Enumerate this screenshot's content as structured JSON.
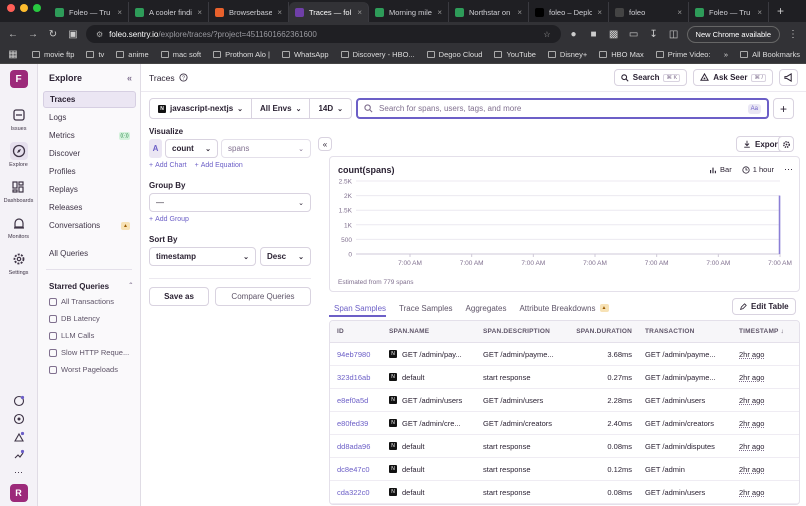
{
  "browser": {
    "tabs": [
      {
        "label": "Foleo — Tru",
        "color": "#2e9c59",
        "active": false
      },
      {
        "label": "A cooler findi",
        "color": "#2e9c59",
        "active": false
      },
      {
        "label": "Browserbase",
        "color": "#e8612c",
        "active": false
      },
      {
        "label": "Traces — fol",
        "color": "#6f3fa8",
        "active": true
      },
      {
        "label": "Morning mile",
        "color": "#2e9c59",
        "active": false
      },
      {
        "label": "Northstar on",
        "color": "#2e9c59",
        "active": false
      },
      {
        "label": "foleo – Deplo",
        "color": "#000000",
        "active": false
      },
      {
        "label": "foleo",
        "color": "#444444",
        "active": false
      },
      {
        "label": "Foleo — Tru",
        "color": "#2e9c59",
        "active": false
      }
    ],
    "url_host": "foleo.sentry.io",
    "url_path": "/explore/traces/?project=4511601662361600",
    "new_chrome": "New Chrome available",
    "bookmarks": [
      "movie ftp",
      "tv",
      "anime",
      "mac soft",
      "Prothom Alo |",
      "WhatsApp",
      "Discovery - HBO...",
      "Degoo Cloud",
      "YouTube",
      "Disney+",
      "HBO Max",
      "Prime Video:"
    ],
    "all_bookmarks": "All Bookmarks"
  },
  "rail": {
    "org_initial": "F",
    "items": [
      {
        "label": "Issues",
        "icon": "issues-icon",
        "active": false
      },
      {
        "label": "Explore",
        "icon": "compass-icon",
        "active": true
      },
      {
        "label": "Dashboards",
        "icon": "dashboard-icon",
        "active": false
      },
      {
        "label": "Monitors",
        "icon": "siren-icon",
        "active": false
      },
      {
        "label": "Settings",
        "icon": "gear-icon",
        "active": false
      }
    ],
    "user_initial": "R"
  },
  "subnav": {
    "title": "Explore",
    "items": [
      "Traces",
      "Logs",
      "Metrics",
      "Discover",
      "Profiles",
      "Replays",
      "Releases",
      "Conversations"
    ],
    "all_queries": "All Queries",
    "starred_title": "Starred Queries",
    "starred": [
      "All Transactions",
      "DB Latency",
      "LLM Calls",
      "Slow HTTP Reque...",
      "Worst Pageloads"
    ]
  },
  "header": {
    "title": "Traces",
    "search_label": "Search",
    "search_kbd": "⌘ K",
    "ask_label": "Ask Seer",
    "ask_kbd": "⌘ /"
  },
  "filters": {
    "project": "javascript-nextjs",
    "env": "All Envs",
    "period": "14D",
    "search_placeholder": "Search for spans, users, tags, and more",
    "aa": "Aa"
  },
  "query": {
    "visualize_label": "Visualize",
    "agg_letter": "A",
    "agg_func": "count",
    "agg_field": "spans",
    "add_chart": "Add Chart",
    "add_equation": "Add Equation",
    "group_by_label": "Group By",
    "group_by_value": "—",
    "add_group": "Add Group",
    "sort_by_label": "Sort By",
    "sort_field": "timestamp",
    "sort_dir": "Desc",
    "save_as": "Save as",
    "compare": "Compare Queries"
  },
  "chart_toolbar": {
    "export": "Export",
    "type_label": "Bar",
    "interval_label": "1 hour"
  },
  "chart_data": {
    "type": "bar",
    "title": "count(spans)",
    "y_ticks": [
      "2.5K",
      "2K",
      "1.5K",
      "1K",
      "500",
      "0"
    ],
    "ylim": [
      0,
      2500
    ],
    "x_tick_labels": [
      "7:00 AM",
      "7:00 AM",
      "7:00 AM",
      "7:00 AM",
      "7:00 AM",
      "7:00 AM",
      "7:00 AM"
    ],
    "num_buckets": 336,
    "series": [
      {
        "values_nonzero": [
          {
            "bucket": 335,
            "value": 2000
          }
        ]
      }
    ],
    "grid": true,
    "color": "#8b7fd6",
    "footer": "Estimated from 779 spans"
  },
  "table_tabs": [
    "Span Samples",
    "Trace Samples",
    "Aggregates",
    "Attribute Breakdowns"
  ],
  "edit_table": "Edit Table",
  "table": {
    "columns": [
      "ID",
      "SPAN.NAME",
      "SPAN.DESCRIPTION",
      "SPAN.DURATION",
      "TRANSACTION",
      "TIMESTAMP"
    ],
    "rows": [
      {
        "id": "94eb7980",
        "name": "GET /admin/pay...",
        "desc": "GET /admin/payme...",
        "dur": "3.68ms",
        "txn": "GET /admin/payme...",
        "ts": "2hr ago"
      },
      {
        "id": "323d16ab",
        "name": "default",
        "desc": "start response",
        "dur": "0.27ms",
        "txn": "GET /admin/payme...",
        "ts": "2hr ago"
      },
      {
        "id": "e8ef0a5d",
        "name": "GET /admin/users",
        "desc": "GET /admin/users",
        "dur": "2.28ms",
        "txn": "GET /admin/users",
        "ts": "2hr ago"
      },
      {
        "id": "e80fed39",
        "name": "GET /admin/cre...",
        "desc": "GET /admin/creators",
        "dur": "2.40ms",
        "txn": "GET /admin/creators",
        "ts": "2hr ago"
      },
      {
        "id": "dd8ada96",
        "name": "default",
        "desc": "start response",
        "dur": "0.08ms",
        "txn": "GET /admin/disputes",
        "ts": "2hr ago"
      },
      {
        "id": "dc8e47c0",
        "name": "default",
        "desc": "start response",
        "dur": "0.12ms",
        "txn": "GET /admin",
        "ts": "2hr ago"
      },
      {
        "id": "cda322c0",
        "name": "default",
        "desc": "start response",
        "dur": "0.08ms",
        "txn": "GET /admin/users",
        "ts": "2hr ago"
      }
    ]
  }
}
